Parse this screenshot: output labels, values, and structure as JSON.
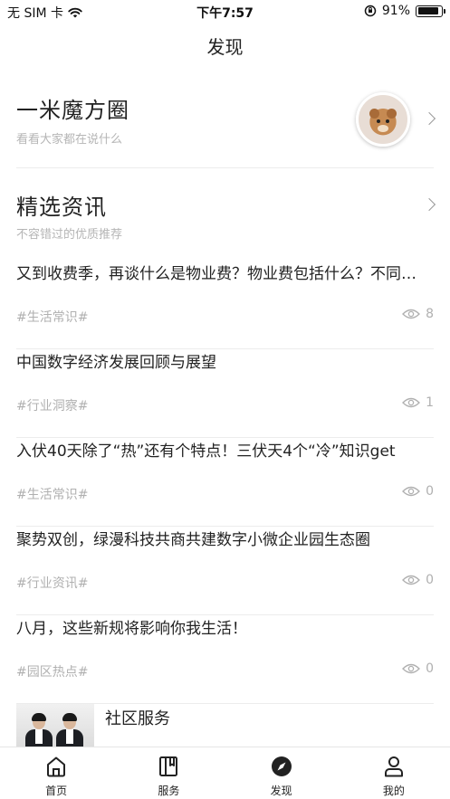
{
  "status_bar": {
    "carrier": "无 SIM 卡",
    "time": "下午7:57",
    "battery": "91%",
    "battery_level": 0.91,
    "icons": [
      "wifi-icon",
      "orientation-lock-icon",
      "battery-icon"
    ]
  },
  "nav": {
    "title": "发现"
  },
  "circle": {
    "title": "一米魔方圈",
    "subtitle": "看看大家都在说什么",
    "avatar_icon": "bear-avatar"
  },
  "featured": {
    "title": "精选资讯",
    "subtitle": "不容错过的优质推荐"
  },
  "news": [
    {
      "title": "又到收费季，再谈什么是物业费？物业费包括什么？不同物业费的区别",
      "tag": "#生活常识#",
      "views": "8"
    },
    {
      "title": "中国数字经济发展回顾与展望",
      "tag": "#行业洞察#",
      "views": "1"
    },
    {
      "title": "入伏40天除了“热”还有个特点！三伏天4个“冷”知识get",
      "tag": "#生活常识#",
      "views": "0"
    },
    {
      "title": "聚势双创，绿漫科技共商共建数字小微企业园生态圈",
      "tag": "#行业资讯#",
      "views": "0"
    },
    {
      "title": "八月，这些新规将影响你我生活！",
      "tag": "#园区热点#",
      "views": "0"
    }
  ],
  "service": {
    "label": "社区服务"
  },
  "tabbar": {
    "items": [
      {
        "label": "首页",
        "icon": "home-icon"
      },
      {
        "label": "服务",
        "icon": "book-icon"
      },
      {
        "label": "发现",
        "icon": "compass-icon"
      },
      {
        "label": "我的",
        "icon": "user-icon"
      }
    ]
  },
  "colors": {
    "text": "#222222",
    "muted": "#b0b0b0",
    "divider": "#ececec"
  }
}
